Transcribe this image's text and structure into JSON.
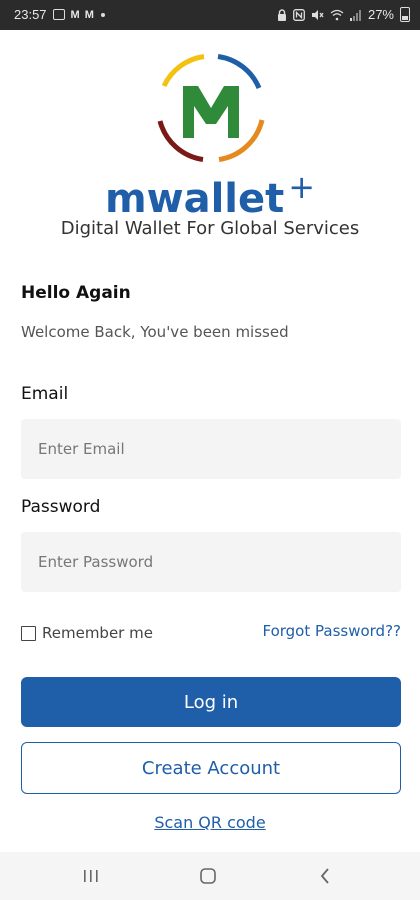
{
  "status_bar": {
    "time": "23:57",
    "battery": "27%",
    "left_icons": [
      "image-icon",
      "mail-icon",
      "mail-icon",
      "dot-icon"
    ],
    "right_icons": [
      "lock-icon",
      "nfc-icon",
      "mute-icon",
      "wifi-icon",
      "signal-icon",
      "battery-icon"
    ]
  },
  "logo": {
    "letter": "M",
    "brand": "mwallet",
    "brand_suffix": "+",
    "tagline": "Digital Wallet For Global Services",
    "colors": {
      "blue": "#1f5ea8",
      "green": "#2f8a3a",
      "yellow": "#f2c20f",
      "orange": "#e58a1f",
      "dark_red": "#7a1a17"
    }
  },
  "greeting": {
    "title": "Hello Again",
    "subtitle": "Welcome Back, You've been missed"
  },
  "form": {
    "email_label": "Email",
    "email_placeholder": "Enter Email",
    "email_value": "",
    "password_label": "Password",
    "password_placeholder": "Enter Password",
    "password_value": "",
    "remember_label": "Remember me",
    "remember_checked": false,
    "forgot_label": "Forgot Password??"
  },
  "actions": {
    "login_label": "Log in",
    "create_label": "Create Account",
    "scan_label": "Scan QR code"
  },
  "nav": {
    "icons": [
      "recent-apps-icon",
      "home-icon",
      "back-icon"
    ]
  },
  "colors": {
    "accent": "#1f5ea8",
    "input_bg": "#f4f4f4",
    "status_bar_bg": "#2b2b2b"
  }
}
